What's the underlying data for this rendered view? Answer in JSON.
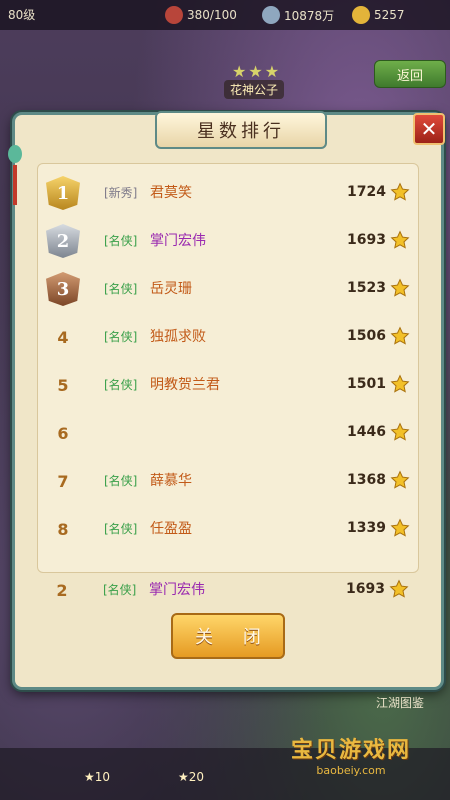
{
  "topbar": {
    "level": "80级",
    "stamina": "380/100",
    "silver": "10878万",
    "gold": "5257"
  },
  "stage": {
    "stars": "★★★",
    "name": "花神公子"
  },
  "back_label": "返回",
  "dialog": {
    "title": "星数排行",
    "close_label": "关 闭",
    "rows": [
      {
        "rank": "1",
        "tag": "[新秀]",
        "name": "君莫笑",
        "score": "1724"
      },
      {
        "rank": "2",
        "tag": "[名侠]",
        "name": "掌门宏伟",
        "score": "1693"
      },
      {
        "rank": "3",
        "tag": "[名侠]",
        "name": "岳灵珊",
        "score": "1523"
      },
      {
        "rank": "4",
        "tag": "[名侠]",
        "name": "独孤求败",
        "score": "1506"
      },
      {
        "rank": "5",
        "tag": "[名侠]",
        "name": "明教贺兰君",
        "score": "1501"
      },
      {
        "rank": "6",
        "tag": "",
        "name": "",
        "score": "1446"
      },
      {
        "rank": "7",
        "tag": "[名侠]",
        "name": "薛慕华",
        "score": "1368"
      },
      {
        "rank": "8",
        "tag": "[名侠]",
        "name": "任盈盈",
        "score": "1339"
      }
    ],
    "self": {
      "rank": "2",
      "tag": "[名侠]",
      "name": "掌门宏伟",
      "score": "1693"
    }
  },
  "side_link": "江湖图鉴",
  "chests": [
    "★10",
    "★20"
  ],
  "watermark": {
    "title": "宝贝游戏网",
    "url": "baobeiy.com"
  }
}
